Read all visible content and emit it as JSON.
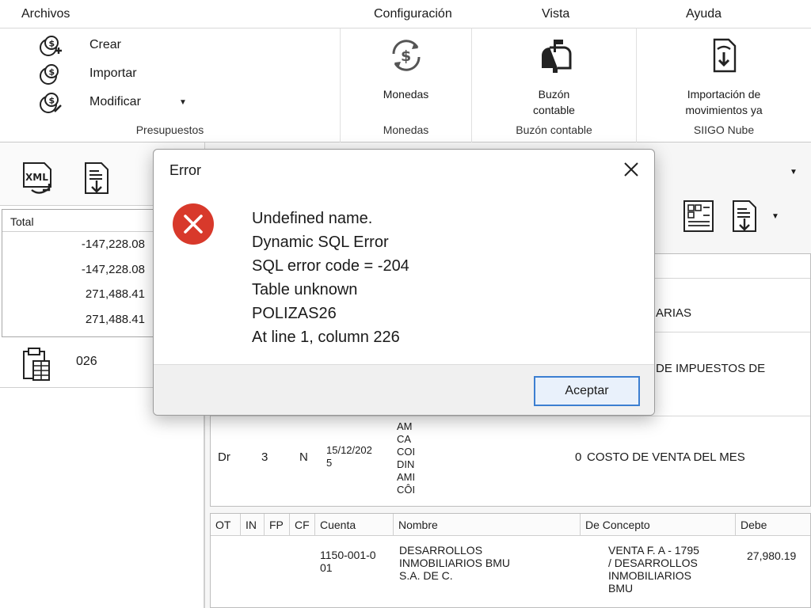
{
  "menu": [
    "Archivos",
    "Configuración",
    "Vista",
    "Ayuda"
  ],
  "ribbon": {
    "presupuestos": {
      "items": [
        "Crear",
        "Importar",
        "Modificar"
      ],
      "title": "Presupuestos"
    },
    "monedas": {
      "label": "Monedas",
      "title": "Monedas"
    },
    "buzon": {
      "label_line1": "Buzón",
      "label_line2": "contable",
      "title": "Buzón contable"
    },
    "siigo": {
      "label_line1": "Importación de",
      "label_line2": "movimientos ya",
      "title": "SIIGO Nube"
    }
  },
  "left": {
    "xml_label": "XML",
    "grid_header": "Total",
    "totals": [
      "-147,228.08",
      "-147,228.08",
      "271,488.41",
      "271,488.41"
    ],
    "number": "026"
  },
  "right": {
    "row_partial_1": "ARIAS",
    "row_partial_2": "DE IMPUESTOS DE",
    "entry": {
      "type": "Dr",
      "num": "3",
      "flag": "N",
      "date_line1": "15/12/202",
      "date_line2": "5",
      "stack": [
        "AM",
        "CA",
        "COI",
        "DIN",
        "AMI",
        "CÔI"
      ],
      "amount": "0",
      "concept": "COSTO DE VENTA DEL MES"
    },
    "detail_headers": [
      "OT",
      "IN",
      "FP",
      "CF",
      "Cuenta",
      "Nombre",
      "De Concepto",
      "Debe"
    ],
    "detail_row": {
      "cuenta_line1": "1150-001-0",
      "cuenta_line2": "01",
      "nombre_line1": "DESARROLLOS",
      "nombre_line2": "INMOBILIARIOS  BMU",
      "nombre_line3": "S.A. DE C.",
      "concepto_line1": "VENTA F. A - 1795",
      "concepto_line2": "/ DESARROLLOS",
      "concepto_line3": "INMOBILIARIOS",
      "concepto_line4": "BMU",
      "debe": "27,980.19"
    }
  },
  "dialog": {
    "title": "Error",
    "lines": [
      "Undefined name.",
      "Dynamic SQL Error",
      "SQL error code = -204",
      "Table unknown",
      "POLIZAS26",
      "At line 1, column 226"
    ],
    "button": "Aceptar"
  },
  "colors": {
    "error_red": "#d8392b",
    "button_border": "#3c7fd1"
  }
}
